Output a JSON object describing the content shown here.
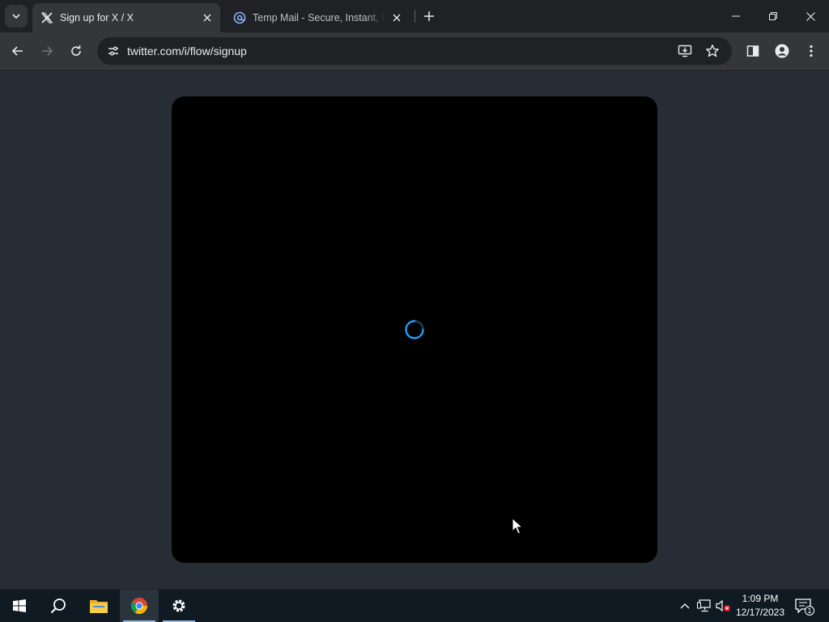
{
  "browser": {
    "tabs": [
      {
        "title": "Sign up for X / X",
        "active": true,
        "icon": "x-logo-icon"
      },
      {
        "title": "Temp Mail - Secure, Instant, Fast",
        "active": false,
        "icon": "temp-mail-at-icon"
      }
    ],
    "address_bar": {
      "url": "twitter.com/i/flow/signup"
    }
  },
  "page": {
    "modal": {
      "state": "loading",
      "icon": "loading-spinner-icon"
    }
  },
  "taskbar": {
    "apps": [
      "windows-start-icon",
      "search-icon",
      "file-explorer-icon",
      "chrome-icon",
      "settings-icon"
    ],
    "active_app": "chrome-icon",
    "clock": {
      "time": "1:09 PM",
      "date": "12/17/2023"
    },
    "notification_count": "1"
  },
  "colors": {
    "page_background": "#262d34",
    "modal_background": "#000000",
    "spinner": "#1d9bf0",
    "taskbar": "#101a22"
  }
}
